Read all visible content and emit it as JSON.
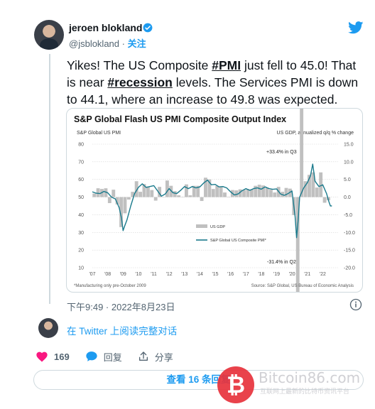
{
  "author": {
    "name": "jeroen blokland",
    "handle": "@jsblokland",
    "separator": "·",
    "follow_label": "关注"
  },
  "tweet": {
    "part1": "Yikes! The US Composite ",
    "hashtag1": "#PMI",
    "part2": " just fell to 45.0! That is near ",
    "hashtag2": "#recession",
    "part3": " levels. The Services PMI is down to 44.1, where an increase to 49.8 was expected."
  },
  "chart_data": {
    "type": "line",
    "title": "S&P Global Flash US PMI Composite Output Index",
    "left_axis_title": "S&P Global US PMI",
    "right_axis_title": "US GDP, annualized q/q % change",
    "x_tick_labels": [
      "'07",
      "'08",
      "'09",
      "'10",
      "'11",
      "'12",
      "'13",
      "'14",
      "'15",
      "'16",
      "'17",
      "'18",
      "'19",
      "'20",
      "'21",
      "'22"
    ],
    "left_ticks": [
      "80",
      "70",
      "60",
      "50",
      "40",
      "30",
      "20",
      "10"
    ],
    "right_ticks": [
      "15.0",
      "10.0",
      "5.0",
      "0.0",
      "-5.0",
      "-10.0",
      "-15.0",
      "-20.0"
    ],
    "ylim_left": [
      10,
      80
    ],
    "ylim_right": [
      -20,
      15
    ],
    "annotations": {
      "high": "+33.4% in Q3",
      "low": "-31.4% in Q2"
    },
    "legend": {
      "bars": "US GDP",
      "line": "S&P Global US Composite PMI*"
    },
    "footnote": "*Manufacturing only pre-October 2009",
    "source": "Source: S&P Global, US Bureau of Economic Analysis",
    "series": [
      {
        "name": "S&P Global US Composite PMI*",
        "color": "#1a7a8c",
        "x": [
          2007.0,
          2007.25,
          2007.5,
          2007.75,
          2008.0,
          2008.25,
          2008.5,
          2008.75,
          2008.9,
          2009.0,
          2009.1,
          2009.25,
          2009.5,
          2009.75,
          2010.0,
          2010.25,
          2010.5,
          2010.75,
          2011.0,
          2011.25,
          2011.5,
          2011.75,
          2012.0,
          2012.25,
          2012.5,
          2012.75,
          2013.0,
          2013.25,
          2013.5,
          2013.75,
          2014.0,
          2014.25,
          2014.5,
          2014.75,
          2015.0,
          2015.25,
          2015.5,
          2015.75,
          2016.0,
          2016.25,
          2016.5,
          2016.75,
          2017.0,
          2017.25,
          2017.5,
          2017.75,
          2018.0,
          2018.25,
          2018.5,
          2018.75,
          2019.0,
          2019.25,
          2019.5,
          2019.75,
          2020.0,
          2020.2,
          2020.3,
          2020.4,
          2020.5,
          2020.75,
          2021.0,
          2021.2,
          2021.35,
          2021.5,
          2021.75,
          2022.0,
          2022.25,
          2022.4,
          2022.5,
          2022.6
        ],
        "values": [
          53.0,
          52.2,
          52.0,
          53.2,
          52.5,
          50.0,
          49.0,
          44.0,
          38.0,
          31.0,
          33.5,
          37.0,
          45.0,
          52.0,
          55.5,
          57.5,
          55.5,
          56.0,
          56.5,
          53.5,
          50.5,
          51.8,
          54.8,
          52.5,
          52.0,
          53.8,
          56.0,
          54.8,
          56.0,
          55.2,
          55.8,
          58.0,
          59.6,
          57.0,
          57.2,
          55.8,
          56.0,
          55.2,
          53.0,
          51.2,
          51.8,
          53.6,
          54.8,
          53.8,
          54.8,
          55.2,
          54.5,
          55.8,
          54.8,
          54.4,
          54.6,
          51.8,
          51.0,
          52.0,
          53.5,
          39.0,
          27.0,
          37.0,
          50.0,
          55.0,
          58.2,
          62.0,
          68.7,
          59.0,
          56.0,
          57.0,
          52.0,
          47.5,
          45.0,
          45.0
        ]
      },
      {
        "name": "US GDP",
        "color": "#c0c0c0",
        "x": [
          2007.0,
          2007.25,
          2007.5,
          2007.75,
          2008.0,
          2008.25,
          2008.5,
          2008.75,
          2009.0,
          2009.25,
          2009.5,
          2009.75,
          2010.0,
          2010.25,
          2010.5,
          2010.75,
          2011.0,
          2011.25,
          2011.5,
          2011.75,
          2012.0,
          2012.25,
          2012.5,
          2012.75,
          2013.0,
          2013.25,
          2013.5,
          2013.75,
          2014.0,
          2014.25,
          2014.5,
          2014.75,
          2015.0,
          2015.25,
          2015.5,
          2015.75,
          2016.0,
          2016.25,
          2016.5,
          2016.75,
          2017.0,
          2017.25,
          2017.5,
          2017.75,
          2018.0,
          2018.25,
          2018.5,
          2018.75,
          2019.0,
          2019.25,
          2019.5,
          2019.75,
          2020.0,
          2020.25,
          2020.5,
          2020.75,
          2021.0,
          2021.25,
          2021.5,
          2021.75,
          2022.0,
          2022.25
        ],
        "values": [
          1.0,
          2.5,
          2.3,
          2.5,
          -1.7,
          2.1,
          -2.1,
          -8.5,
          -4.6,
          -0.7,
          1.5,
          4.5,
          1.5,
          3.7,
          3.0,
          2.0,
          -1.0,
          2.9,
          -0.1,
          4.7,
          3.2,
          1.7,
          0.5,
          0.1,
          3.6,
          0.5,
          3.2,
          3.2,
          -1.1,
          5.5,
          5.0,
          2.3,
          3.2,
          3.0,
          1.3,
          0.1,
          2.0,
          1.9,
          2.2,
          2.0,
          2.3,
          2.2,
          3.2,
          3.5,
          3.3,
          2.7,
          2.1,
          1.3,
          2.9,
          1.5,
          2.6,
          2.4,
          -5.1,
          -31.4,
          33.4,
          4.5,
          6.3,
          7.0,
          2.7,
          7.0,
          -1.6,
          -0.9
        ]
      }
    ]
  },
  "meta": {
    "timestamp": "下午9:49 · 2022年8月23日",
    "reply_link": "在 Twitter 上阅读完整对话"
  },
  "actions": {
    "like_count": "169",
    "reply_label": "回复",
    "share_label": "分享"
  },
  "more_button": "查看 16 条回复",
  "watermark": {
    "text": "Bitcoin86.com",
    "sub": "互联网上最新的比特币资讯平台"
  },
  "colors": {
    "accent": "#1d9bf0",
    "like": "#f91880",
    "pmi_line": "#1a7a8c",
    "gdp_bars": "#c0c0c0"
  }
}
